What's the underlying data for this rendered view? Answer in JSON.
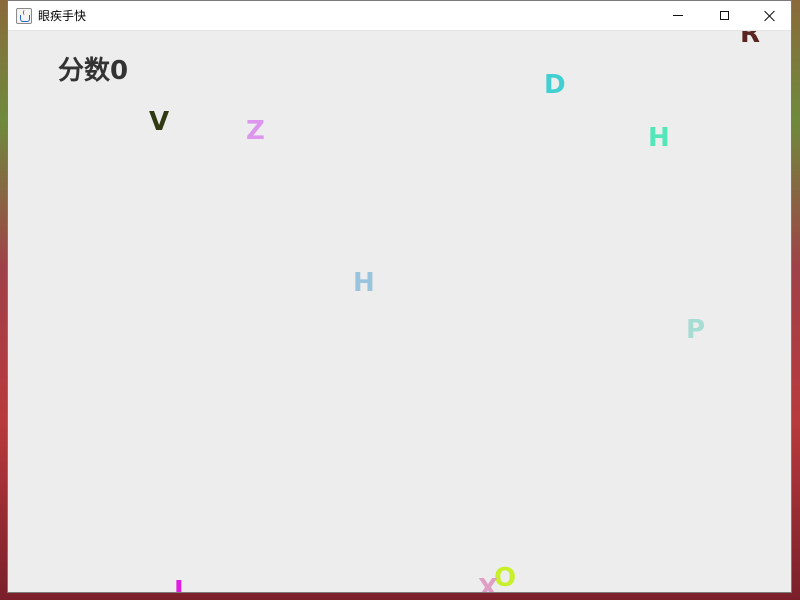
{
  "window": {
    "title": "眼疾手快",
    "app_icon": "java-cup-icon",
    "controls": {
      "minimize": "minimize-icon",
      "maximize": "maximize-icon",
      "close": "close-icon"
    }
  },
  "game": {
    "score_label": "分数0",
    "letters": [
      {
        "char": "R",
        "color": "#5a2420"
      },
      {
        "char": "D",
        "color": "#41cfd1"
      },
      {
        "char": "V",
        "color": "#2f3a12"
      },
      {
        "char": "Z",
        "color": "#dc96ee"
      },
      {
        "char": "H",
        "color": "#52e6b8"
      },
      {
        "char": "H",
        "color": "#98c4dd"
      },
      {
        "char": "P",
        "color": "#a7dcd3"
      },
      {
        "char": "O",
        "color": "#c8f02a"
      },
      {
        "char": "X",
        "color": "#dfa0c6"
      },
      {
        "char": "I",
        "color": "#e11be0"
      }
    ],
    "background_color": "#ededed"
  }
}
